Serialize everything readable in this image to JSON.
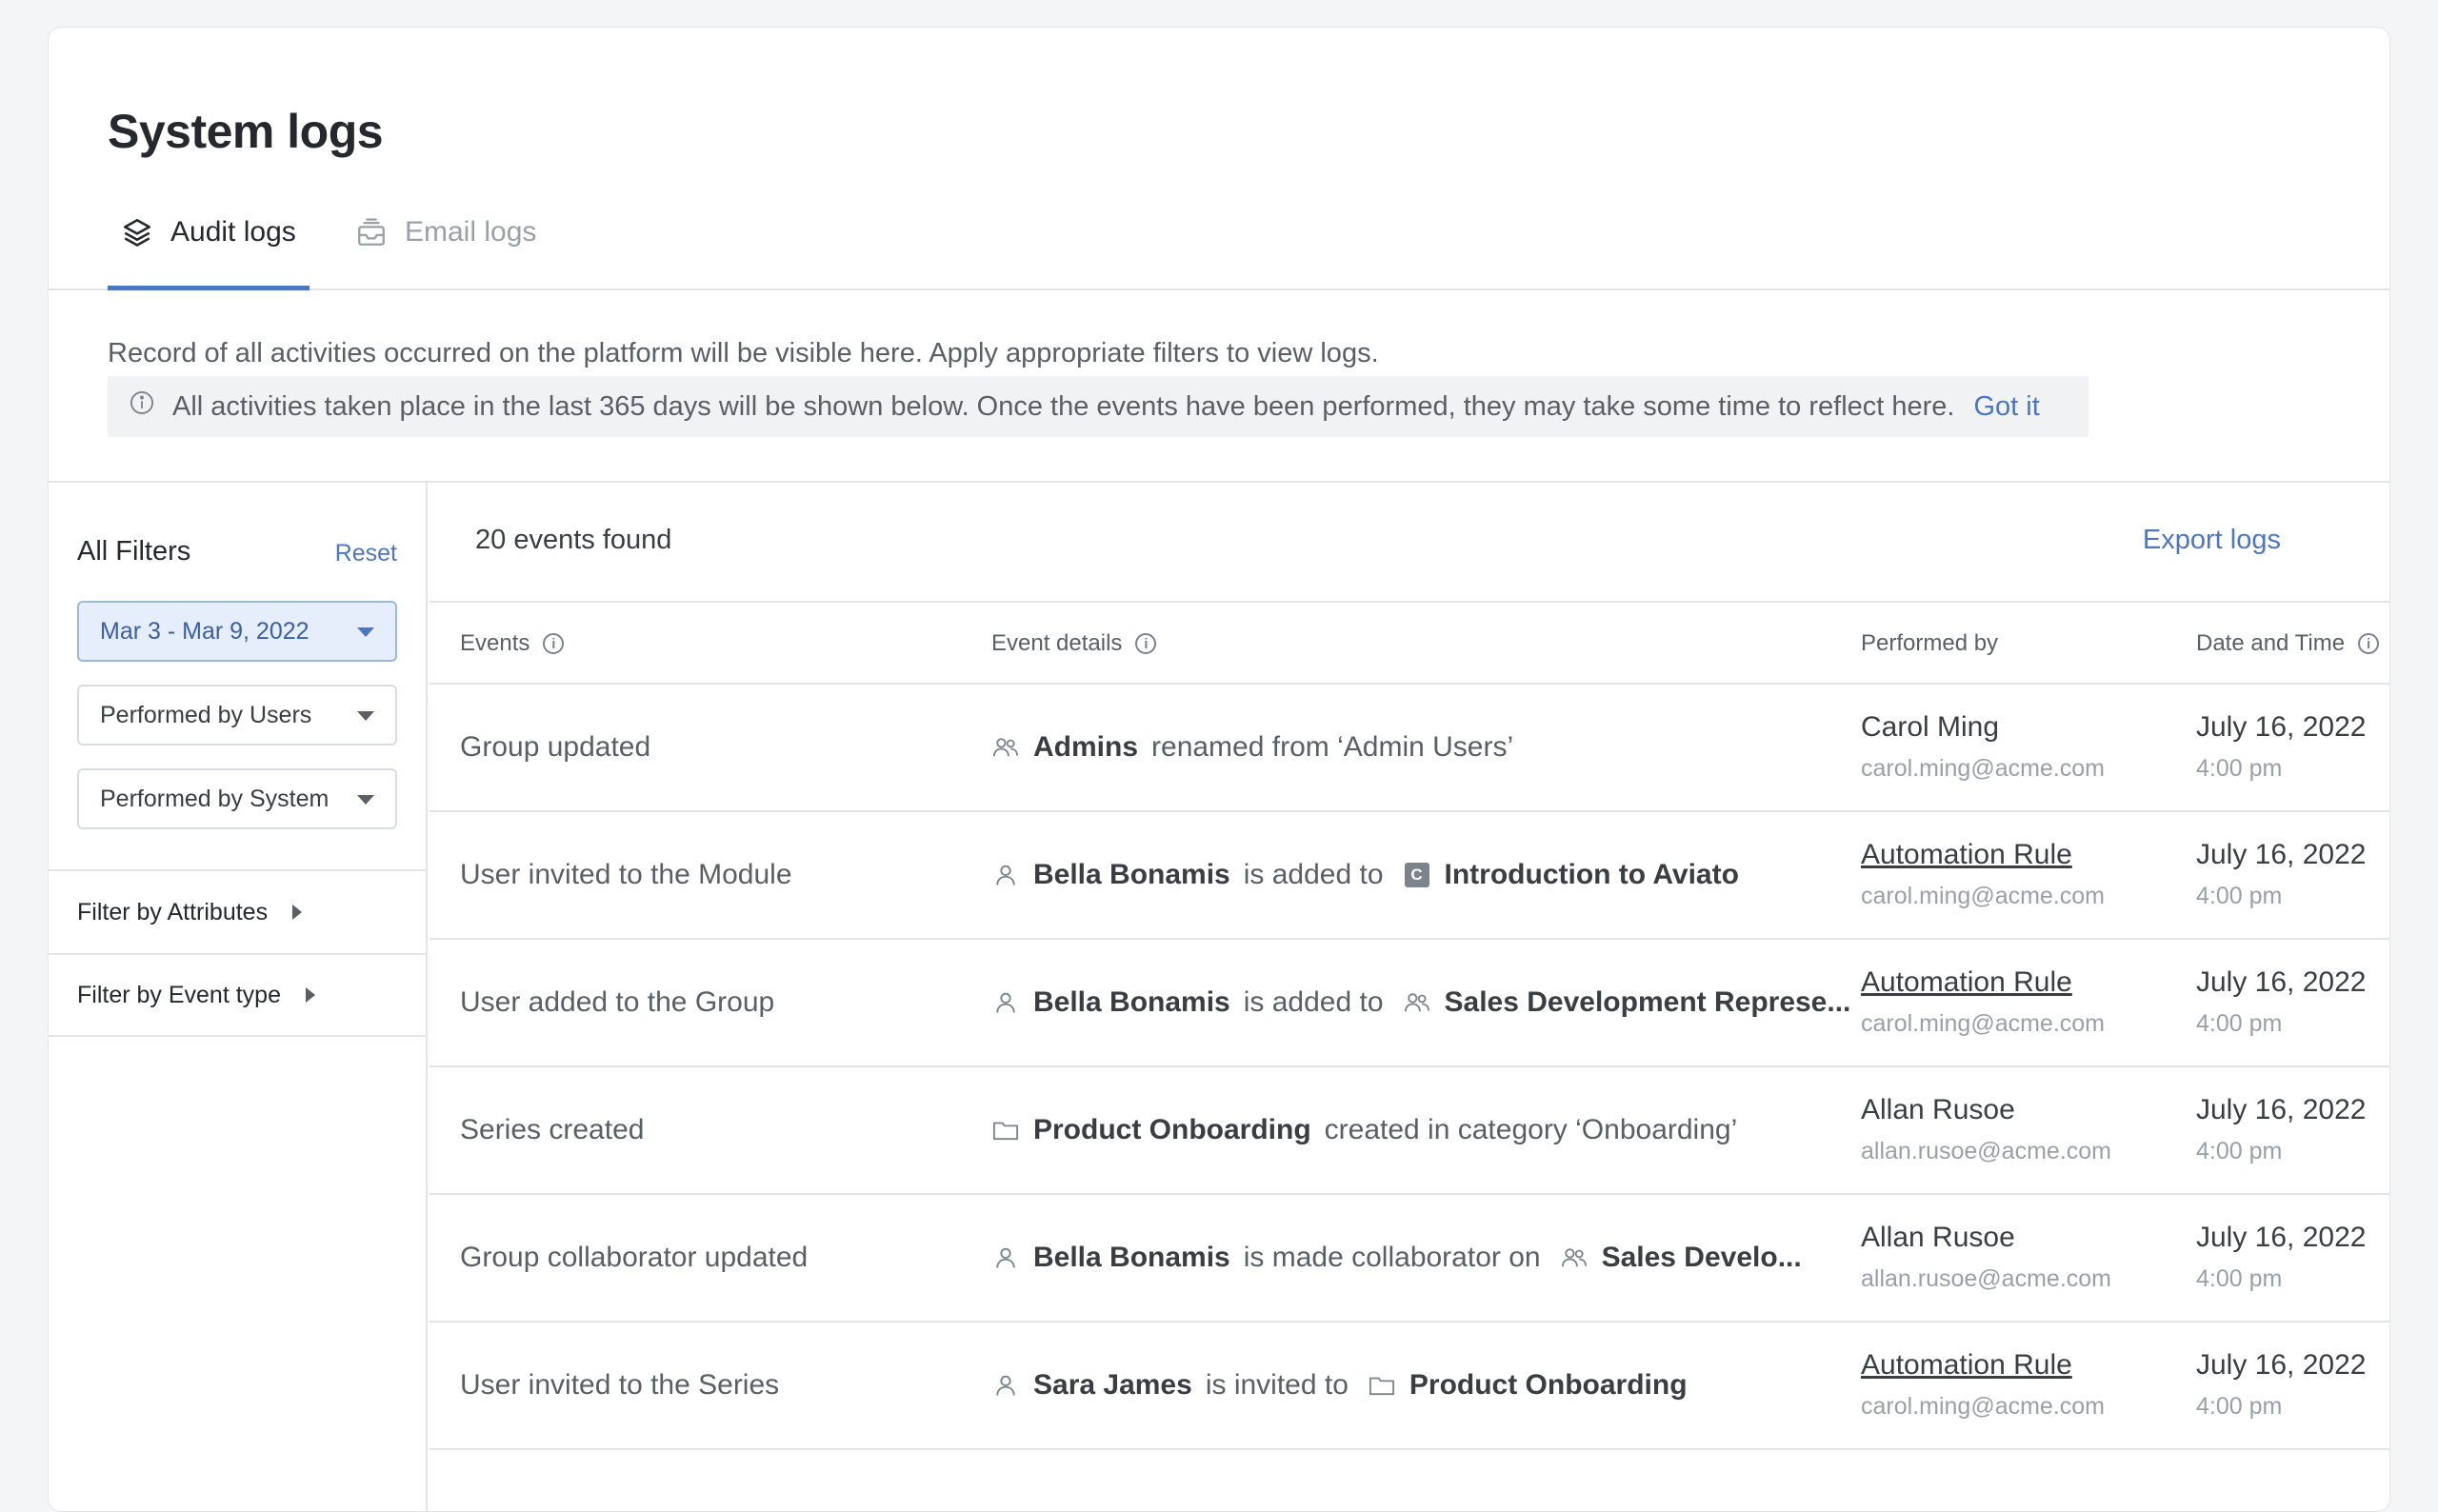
{
  "page": {
    "title": "System logs"
  },
  "tabs": [
    {
      "label": "Audit logs",
      "icon": "layers-icon",
      "active": true
    },
    {
      "label": "Email logs",
      "icon": "inbox-icon",
      "active": false
    }
  ],
  "description": "Record of all activities occurred on the platform will be visible here. Apply appropriate filters to view logs.",
  "banner": {
    "icon": "info-icon",
    "text": "All activities taken place in the last 365 days will be shown below. Once the events have been performed, they may take some time to reflect here.",
    "action": "Got it"
  },
  "filters": {
    "title": "All Filters",
    "reset": "Reset",
    "date_range": "Mar 3 - Mar 9, 2022",
    "performed_by_users": "Performed by Users",
    "performed_by_system": "Performed by System",
    "by_attributes": "Filter by Attributes",
    "by_event_type": "Filter by Event type"
  },
  "results": {
    "count_label": "20 events found",
    "export": "Export logs"
  },
  "columns": {
    "events": "Events",
    "event_details": "Event details",
    "performed_by": "Performed by",
    "date_time": "Date and Time"
  },
  "rows": [
    {
      "event": "Group updated",
      "detail": {
        "icon1": "group-icon",
        "subject": "Admins",
        "text": "renamed from ‘Admin Users’",
        "icon2": "",
        "object": ""
      },
      "by_name": "Carol Ming",
      "by_link": false,
      "by_email": "carol.ming@acme.com",
      "date": "July 16, 2022",
      "time": "4:00 pm"
    },
    {
      "event": "User invited to the Module",
      "detail": {
        "icon1": "user-icon",
        "subject": "Bella Bonamis",
        "text": "is added to",
        "icon2": "course-badge-icon",
        "object": "Introduction to Aviato"
      },
      "by_name": "Automation Rule",
      "by_link": true,
      "by_email": "carol.ming@acme.com",
      "date": "July 16, 2022",
      "time": "4:00 pm"
    },
    {
      "event": "User added to the Group",
      "detail": {
        "icon1": "user-icon",
        "subject": "Bella Bonamis",
        "text": "is added to",
        "icon2": "group-icon",
        "object": "Sales Development Represe..."
      },
      "by_name": "Automation Rule",
      "by_link": true,
      "by_email": "carol.ming@acme.com",
      "date": "July 16, 2022",
      "time": "4:00 pm"
    },
    {
      "event": "Series created",
      "detail": {
        "icon1": "folder-icon",
        "subject": "Product Onboarding",
        "text": "created in category ‘Onboarding’",
        "icon2": "",
        "object": ""
      },
      "by_name": "Allan Rusoe",
      "by_link": false,
      "by_email": "allan.rusoe@acme.com",
      "date": "July 16, 2022",
      "time": "4:00 pm"
    },
    {
      "event": "Group collaborator updated",
      "detail": {
        "icon1": "user-icon",
        "subject": "Bella Bonamis",
        "text": "is made collaborator on",
        "icon2": "group-icon",
        "object": "Sales Develo..."
      },
      "by_name": "Allan Rusoe",
      "by_link": false,
      "by_email": "allan.rusoe@acme.com",
      "date": "July 16, 2022",
      "time": "4:00 pm"
    },
    {
      "event": "User invited to the Series",
      "detail": {
        "icon1": "user-icon",
        "subject": "Sara James",
        "text": "is invited to",
        "icon2": "folder-icon",
        "object": "Product Onboarding"
      },
      "by_name": "Automation Rule",
      "by_link": true,
      "by_email": "carol.ming@acme.com",
      "date": "July 16, 2022",
      "time": "4:00 pm"
    }
  ],
  "colors": {
    "accent": "#4d76c2",
    "border": "#e3e5e9",
    "muted": "#9aa0a8"
  }
}
